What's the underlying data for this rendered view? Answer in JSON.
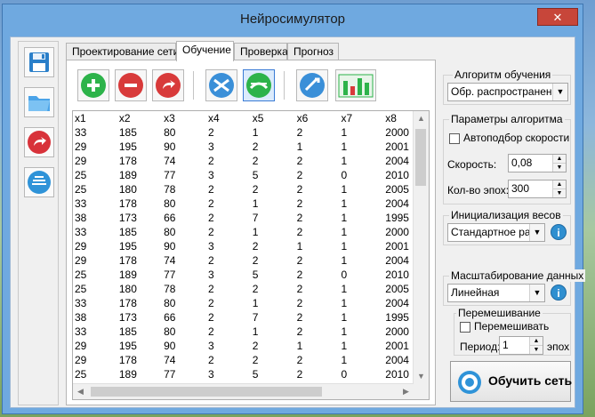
{
  "window": {
    "title": "Нейросимулятор",
    "close_glyph": "✕"
  },
  "sidebar": {
    "buttons": [
      {
        "name": "save-icon"
      },
      {
        "name": "open-folder-icon"
      },
      {
        "name": "redo-icon"
      },
      {
        "name": "network-icon"
      }
    ]
  },
  "tabs": [
    {
      "label": "Проектирование сети",
      "active": false
    },
    {
      "label": "Обучение",
      "active": true
    },
    {
      "label": "Проверка",
      "active": false
    },
    {
      "label": "Прогноз",
      "active": false
    }
  ],
  "toolbar": {
    "buttons": [
      {
        "name": "add-icon",
        "color": "#2db34a"
      },
      {
        "name": "remove-icon",
        "color": "#d83a3a"
      },
      {
        "name": "undo-icon",
        "color": "#d83a3a"
      },
      {
        "name": "shuffle-icon",
        "color": "#3a8fd8"
      },
      {
        "name": "shuffle-alt-icon",
        "color": "#2db34a"
      },
      {
        "name": "scale-icon",
        "color": "#3a8fd8"
      },
      {
        "name": "chart-icon",
        "color": "#2db34a"
      }
    ]
  },
  "table": {
    "columns": [
      "x1",
      "x2",
      "x3",
      "x4",
      "x5",
      "x6",
      "x7",
      "x8"
    ],
    "rows": [
      [
        "33",
        "185",
        "80",
        "2",
        "1",
        "2",
        "1",
        "2000"
      ],
      [
        "29",
        "195",
        "90",
        "3",
        "2",
        "1",
        "1",
        "2001"
      ],
      [
        "29",
        "178",
        "74",
        "2",
        "2",
        "2",
        "1",
        "2004"
      ],
      [
        "25",
        "189",
        "77",
        "3",
        "5",
        "2",
        "0",
        "2010"
      ],
      [
        "25",
        "180",
        "78",
        "2",
        "2",
        "2",
        "1",
        "2005"
      ],
      [
        "33",
        "178",
        "80",
        "2",
        "1",
        "2",
        "1",
        "2004"
      ],
      [
        "38",
        "173",
        "66",
        "2",
        "7",
        "2",
        "1",
        "1995"
      ],
      [
        "33",
        "185",
        "80",
        "2",
        "1",
        "2",
        "1",
        "2000"
      ],
      [
        "29",
        "195",
        "90",
        "3",
        "2",
        "1",
        "1",
        "2001"
      ],
      [
        "29",
        "178",
        "74",
        "2",
        "2",
        "2",
        "1",
        "2004"
      ],
      [
        "25",
        "189",
        "77",
        "3",
        "5",
        "2",
        "0",
        "2010"
      ],
      [
        "25",
        "180",
        "78",
        "2",
        "2",
        "2",
        "1",
        "2005"
      ],
      [
        "33",
        "178",
        "80",
        "2",
        "1",
        "2",
        "1",
        "2004"
      ],
      [
        "38",
        "173",
        "66",
        "2",
        "7",
        "2",
        "1",
        "1995"
      ],
      [
        "33",
        "185",
        "80",
        "2",
        "1",
        "2",
        "1",
        "2000"
      ],
      [
        "29",
        "195",
        "90",
        "3",
        "2",
        "1",
        "1",
        "2001"
      ],
      [
        "29",
        "178",
        "74",
        "2",
        "2",
        "2",
        "1",
        "2004"
      ],
      [
        "25",
        "189",
        "77",
        "3",
        "5",
        "2",
        "0",
        "2010"
      ]
    ]
  },
  "algorithm": {
    "group_label": "Алгоритм обучения",
    "selected": "Обр. распространени"
  },
  "params": {
    "group_label": "Параметры алгоритма",
    "auto_speed_label": "Автоподбор скорости",
    "auto_speed_checked": false,
    "speed_label": "Скорость:",
    "speed_value": "0,08",
    "epochs_label": "Кол-во эпох:",
    "epochs_value": "300"
  },
  "init": {
    "group_label": "Инициализация весов",
    "selected": "Стандартное рас"
  },
  "scaling": {
    "group_label": "Масштабирование данных",
    "selected": "Линейная"
  },
  "shuffle": {
    "group_label": "Перемешивание",
    "shuffle_label": "Перемешивать",
    "shuffle_checked": false,
    "period_label": "Период:",
    "period_value": "1",
    "period_unit": "эпох"
  },
  "train_button": {
    "label": "Обучить сеть"
  },
  "info_glyph": "i"
}
